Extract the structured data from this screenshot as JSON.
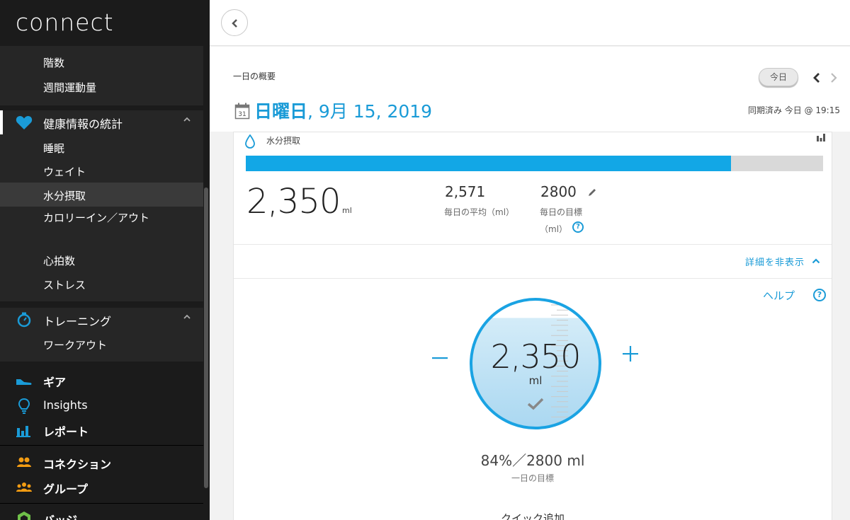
{
  "app": {
    "logo": "connect"
  },
  "sidebar": {
    "activity_items": [
      {
        "label": "階数"
      },
      {
        "label": "週間運動量"
      }
    ],
    "health": {
      "label": "健康情報の統計",
      "items": [
        {
          "label": "睡眠"
        },
        {
          "label": "ウェイト"
        },
        {
          "label": "水分摂取",
          "selected": true
        },
        {
          "label": "カロリーイン／アウト"
        },
        {
          "label": "心拍数"
        },
        {
          "label": "ストレス"
        }
      ]
    },
    "training": {
      "label": "トレーニング",
      "items": [
        {
          "label": "ワークアウト"
        }
      ]
    },
    "gear": {
      "label": "ギア"
    },
    "insights": {
      "label": "Insights"
    },
    "reports": {
      "label": "レポート"
    },
    "connections": {
      "label": "コネクション"
    },
    "groups": {
      "label": "グループ"
    },
    "badges": {
      "label": "バッジ"
    },
    "colors": {
      "icon_blue": "#1a9bd7",
      "icon_orange": "#f39c12",
      "icon_green": "#6fc049"
    }
  },
  "summary": {
    "title": "一日の概要",
    "date_dow": "日曜日",
    "date_rest": ", 9月 15, 2019",
    "calendar_day": "31",
    "today_button": "今日",
    "synced": "同期済み 今日 @ 19:15"
  },
  "hydration": {
    "title": "水分摂取",
    "intake_value": "2,350",
    "intake_unit": "ml",
    "progress_fraction": 0.84,
    "avg_value": "2,571",
    "avg_label": "毎日の平均（ml）",
    "goal_value": "2800",
    "goal_label_line1": "毎日の目標",
    "goal_label_line2": "（ml）",
    "detail_toggle": "詳細を非表示",
    "help_label": "ヘルプ",
    "circle_value": "2,350",
    "circle_unit": "ml",
    "goal_summary": "84%／2800 ml",
    "goal_summary_label": "一日の目標",
    "quick_add": "クイック追加",
    "accent": "#12a7e6"
  }
}
